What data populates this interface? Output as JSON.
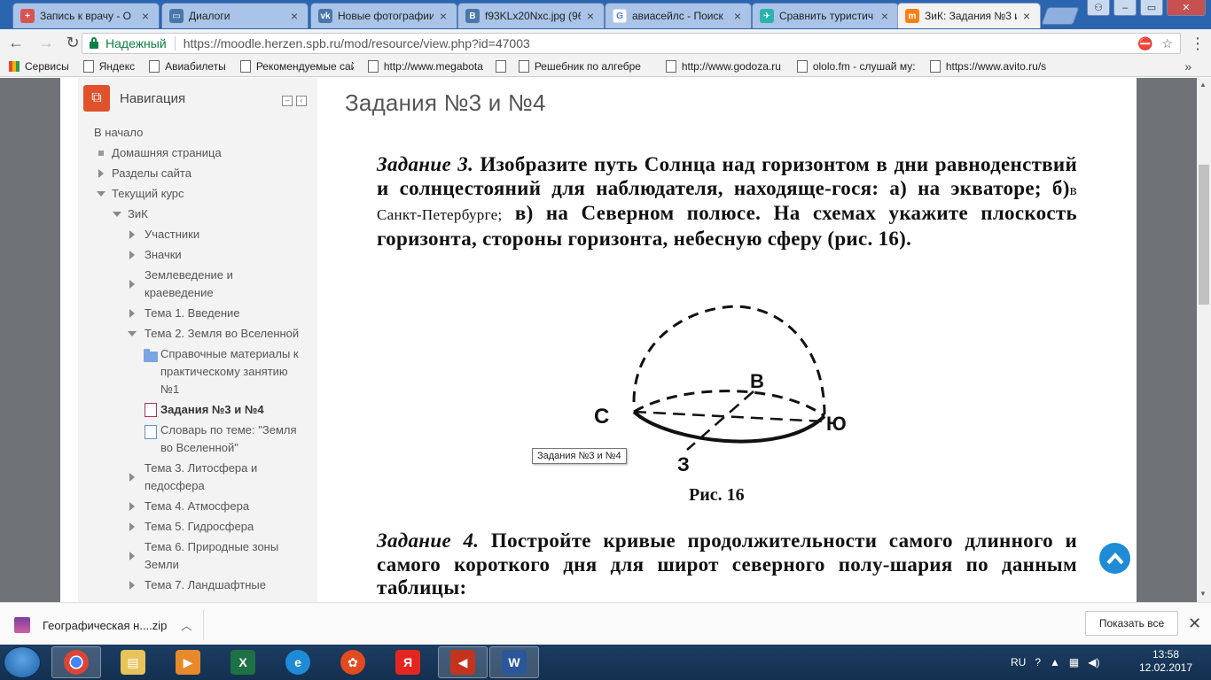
{
  "tabs": [
    {
      "title": "Запись к врачу - О",
      "icon": "medical-cross-icon",
      "color": "#d9534f"
    },
    {
      "title": "Диалоги",
      "icon": "vk-chat-icon",
      "color": "#4a76a8"
    },
    {
      "title": "Новые фотографии",
      "icon": "vk-logo-icon",
      "color": "#4a76a8"
    },
    {
      "title": "f93KLx20Nxc.jpg (96",
      "icon": "vk-b-icon",
      "color": "#4a76a8"
    },
    {
      "title": "авиасейлс - Поиск",
      "icon": "google-g-icon",
      "color": "#4285f4"
    },
    {
      "title": "Сравнить туристич",
      "icon": "travel-icon",
      "color": "#2bb3a9"
    },
    {
      "title": "ЗиК: Задания №3 и",
      "icon": "moodle-m-icon",
      "color": "#f98012"
    }
  ],
  "address": {
    "secure_label": "Надежный",
    "url": "https://moodle.herzen.spb.ru/mod/resource/view.php?id=47003"
  },
  "bookmarks": [
    "Сервисы",
    "Яндекс",
    "Авиабилеты",
    "Рекомендуемые сайт",
    "http://www.megabota",
    "",
    "Решебник по алгебре",
    "http://www.godoza.ru",
    "ololo.fm - слушай му:",
    "https://www.avito.ru/s"
  ],
  "nav": {
    "title": "Навигация",
    "items": [
      "В начало",
      "Домашняя страница",
      "Разделы сайта",
      "Текущий курс",
      "ЗиК",
      "Участники",
      "Значки",
      "Землеведение и",
      "краеведение",
      "Тема 1. Введение",
      "Тема 2. Земля во Вселенной",
      "Справочные материалы к",
      "практическому занятию",
      "№1",
      "Задания №3 и №4",
      "Словарь по теме: \"Земля",
      "во Вселенной\"",
      "Тема 3. Литосфера и",
      "педосфера",
      "Тема 4. Атмосфера",
      "Тема 5. Гидросфера",
      "Тема 6. Природные зоны",
      "Земли",
      "Тема 7. Ландшафтные"
    ]
  },
  "content": {
    "title": "Задания №3 и №4",
    "task3_label": "Задание 3.",
    "task3_text1": " Изобразите путь Солнца над горизонтом в дни равноденствий и солнцестояний для наблюдателя, находяще-гося: а) на экваторе; б)",
    "task3_inserted": "в Санкт-Петербурге;",
    "task3_text2": " в) на Северном полюсе. На схемах укажите плоскость горизонта, стороны горизонта, небесную сферу (рис. 16).",
    "fig_labels": {
      "north": "С",
      "east": "В",
      "south": "Ю",
      "west": "З"
    },
    "caption": "Рис. 16",
    "task4_label": "Задание 4.",
    "task4_text": " Постройте кривые продолжительности самого длинного и самого короткого дня для широт северного полу-шария по данным таблицы:",
    "tooltip": "Задания №3 и №4"
  },
  "downloads": {
    "file": "Географическая н....zip",
    "show_all": "Показать все"
  },
  "taskbar": {
    "lang": "RU",
    "time": "13:58",
    "date": "12.02.2017",
    "apps": [
      "chrome-icon",
      "explorer-icon",
      "media-player-icon",
      "excel-icon",
      "ie-icon",
      "media-center-icon",
      "yandex-icon",
      "audio-editor-icon",
      "word-icon"
    ]
  }
}
